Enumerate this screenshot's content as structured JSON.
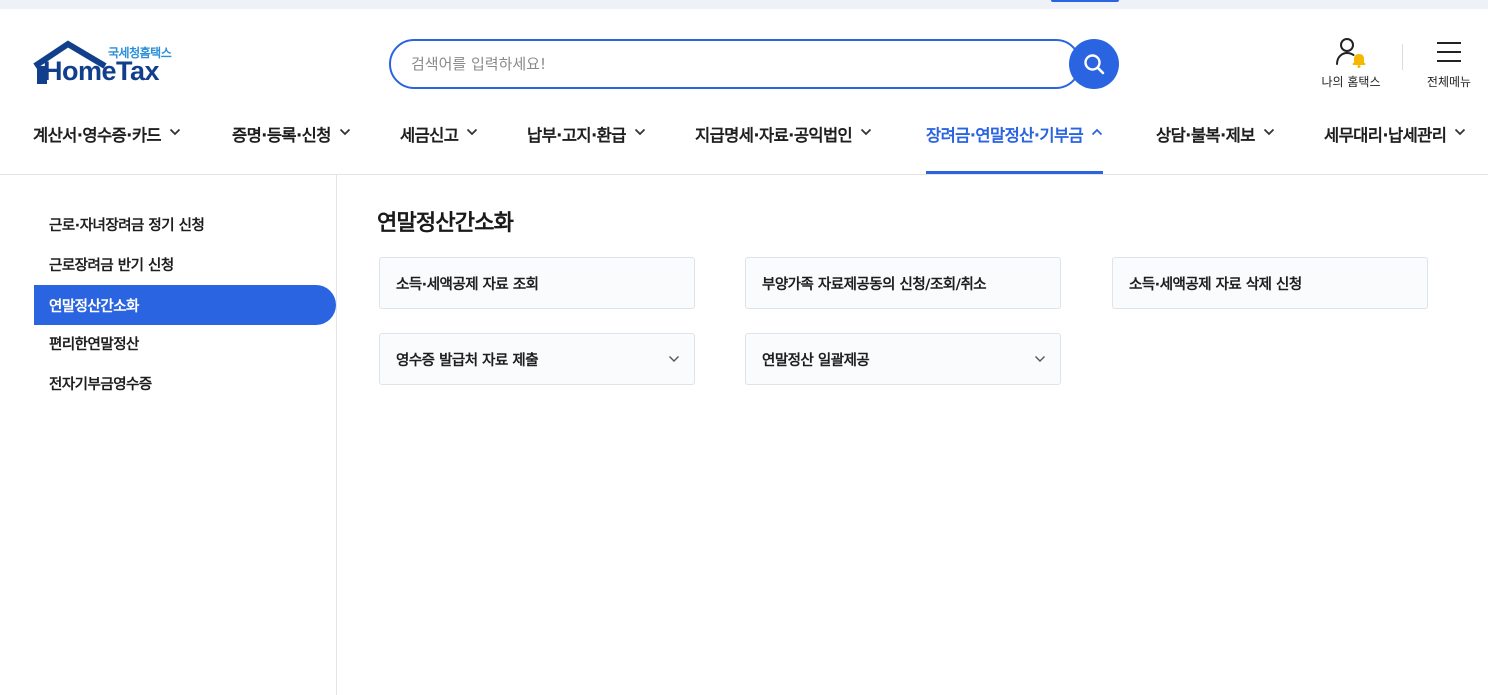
{
  "logo": {
    "sub": "국세청홈택스",
    "main": "HomeTax"
  },
  "search": {
    "placeholder": "검색어를 입력하세요!",
    "value": ""
  },
  "utility": {
    "my_hometax": "나의 홈택스",
    "all_menu": "전체메뉴"
  },
  "gnb": [
    {
      "label": "계산서·영수증·카드",
      "active": false
    },
    {
      "label": "증명·등록·신청",
      "active": false
    },
    {
      "label": "세금신고",
      "active": false
    },
    {
      "label": "납부·고지·환급",
      "active": false
    },
    {
      "label": "지급명세·자료·공익법인",
      "active": false
    },
    {
      "label": "장려금·연말정산·기부금",
      "active": true
    },
    {
      "label": "상담·불복·제보",
      "active": false
    },
    {
      "label": "세무대리·납세관리",
      "active": false
    }
  ],
  "lnb": [
    {
      "label": "근로·자녀장려금 정기 신청",
      "active": false
    },
    {
      "label": "근로장려금 반기 신청",
      "active": false
    },
    {
      "label": "연말정산간소화",
      "active": true
    },
    {
      "label": "편리한연말정산",
      "active": false
    },
    {
      "label": "전자기부금영수증",
      "active": false
    }
  ],
  "content": {
    "title": "연말정산간소화",
    "cards": [
      {
        "label": "소득·세액공제 자료 조회",
        "expandable": false
      },
      {
        "label": "부양가족 자료제공동의 신청/조회/취소",
        "expandable": false
      },
      {
        "label": "소득·세액공제 자료 삭제 신청",
        "expandable": false
      },
      {
        "label": "영수증 발급처 자료 제출",
        "expandable": true
      },
      {
        "label": "연말정산 일괄제공",
        "expandable": true
      }
    ]
  },
  "colors": {
    "accent": "#2a64e0",
    "logo_dark": "#123f8c",
    "logo_light": "#2a8fd8",
    "bell": "#f5b800"
  }
}
